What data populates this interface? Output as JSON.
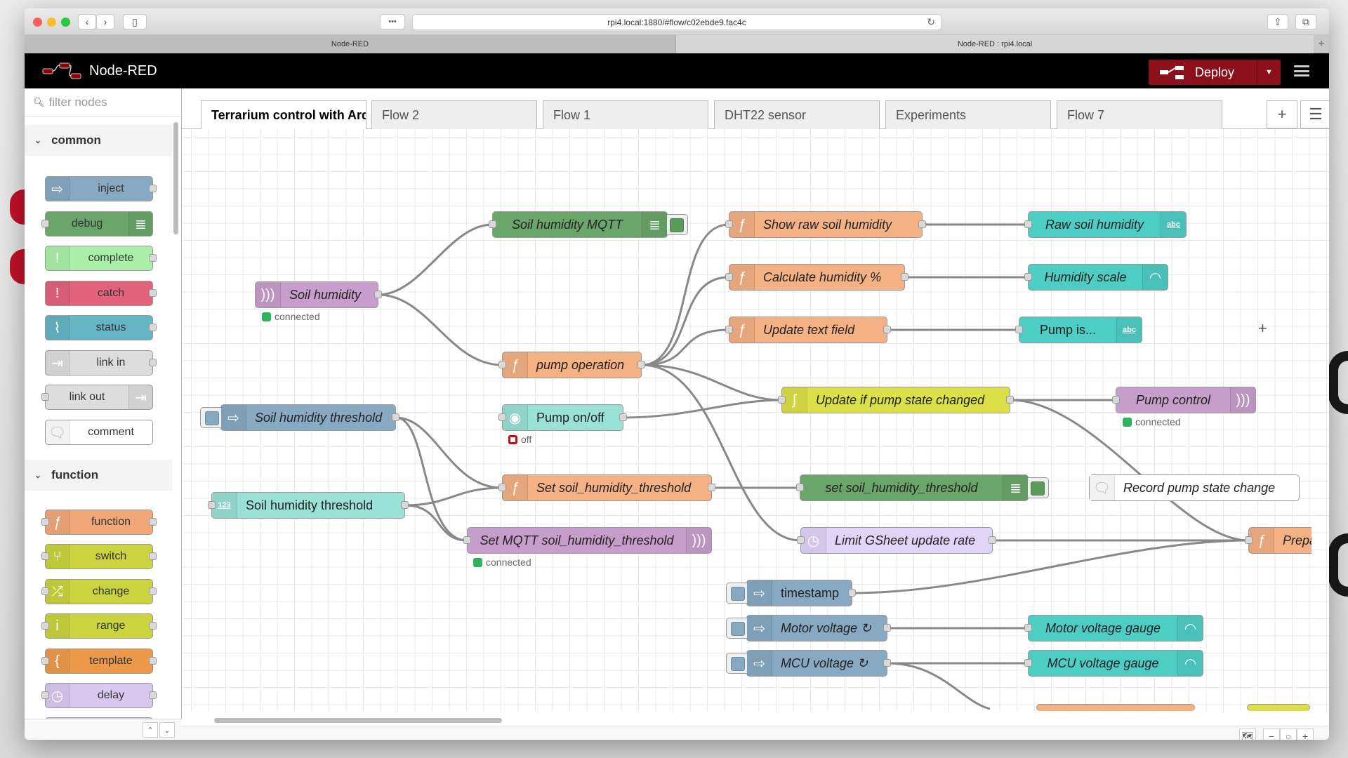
{
  "browser": {
    "url": "rpi4.local:1880/#flow/c02ebde9.fac4c",
    "tabs": [
      {
        "label": "Node-RED",
        "active": false
      },
      {
        "label": "Node-RED : rpi4.local",
        "active": true
      }
    ],
    "reader_icon": "•••",
    "new_tab": "+"
  },
  "header": {
    "app_name": "Node-RED",
    "deploy_label": "Deploy",
    "colors": {
      "deploy_bg": "#8c101c",
      "header_bg": "#000000"
    }
  },
  "palette": {
    "filter_placeholder": "filter nodes",
    "categories": [
      {
        "name": "common",
        "nodes": [
          {
            "label": "inject",
            "icon": "arrow-right-icon",
            "color": "#87a9c2"
          },
          {
            "label": "debug",
            "icon": "list-icon",
            "color": "#87bd87"
          },
          {
            "label": "complete",
            "icon": "exclamation-icon",
            "color": "#c0edc0"
          },
          {
            "label": "catch",
            "icon": "exclamation-icon",
            "color": "#e49191"
          },
          {
            "label": "status",
            "icon": "pulse-icon",
            "color": "#94c1d0"
          },
          {
            "label": "link in",
            "icon": "link-in-icon",
            "color": "#dddddd"
          },
          {
            "label": "link out",
            "icon": "link-out-icon",
            "color": "#dddddd"
          },
          {
            "label": "comment",
            "icon": "comment-icon",
            "color": "#ffffff"
          }
        ]
      },
      {
        "name": "function",
        "nodes": [
          {
            "label": "function",
            "icon": "function-icon",
            "color": "#fdd0a2"
          },
          {
            "label": "switch",
            "icon": "switch-icon",
            "color": "#e2d96e"
          },
          {
            "label": "change",
            "icon": "shuffle-icon",
            "color": "#e2d96e"
          },
          {
            "label": "range",
            "icon": "range-icon",
            "color": "#e2d96e"
          },
          {
            "label": "template",
            "icon": "brace-icon",
            "color": "#f0a15c"
          },
          {
            "label": "delay",
            "icon": "timer-icon",
            "color": "#e6e0f8"
          }
        ]
      }
    ]
  },
  "flow_tabs": [
    {
      "label": "Terrarium control with Arduino",
      "active": true
    },
    {
      "label": "Flow 2",
      "active": false
    },
    {
      "label": "Flow 1",
      "active": false
    },
    {
      "label": "DHT22 sensor",
      "active": false
    },
    {
      "label": "Experiments",
      "active": false
    },
    {
      "label": "Flow 7",
      "active": false
    }
  ],
  "flow": {
    "nodes": [
      {
        "id": "n1",
        "label": "Soil humidity MQTT",
        "type": "debug",
        "italic": true
      },
      {
        "id": "n2",
        "label": "Soil humidity",
        "type": "mqtt in",
        "italic": true,
        "status": "connected",
        "status_color": "#2db35b"
      },
      {
        "id": "n3",
        "label": "Show raw soil humidity",
        "type": "function",
        "italic": true
      },
      {
        "id": "n4",
        "label": "Raw soil humidity",
        "type": "ui_text",
        "italic": true,
        "badge": "abc"
      },
      {
        "id": "n5",
        "label": "Calculate humidity %",
        "type": "function",
        "italic": true
      },
      {
        "id": "n6",
        "label": "Humidity scale",
        "type": "ui_gauge",
        "italic": true
      },
      {
        "id": "n7",
        "label": "Update text field",
        "type": "function",
        "italic": true
      },
      {
        "id": "n8",
        "label": "Pump is...",
        "type": "ui_text",
        "italic": false,
        "badge": "abc"
      },
      {
        "id": "n9",
        "label": "pump operation",
        "type": "function",
        "italic": true
      },
      {
        "id": "n10",
        "label": "Update if pump state changed",
        "type": "rbe",
        "italic": true
      },
      {
        "id": "n11",
        "label": "Pump control",
        "type": "mqtt out",
        "italic": true,
        "status": "connected",
        "status_color": "#2db35b"
      },
      {
        "id": "n12",
        "label": "Soil humidity threshold",
        "type": "inject",
        "italic": true
      },
      {
        "id": "n13",
        "label": "Pump on/off",
        "type": "ui_switch",
        "italic": false,
        "status": "off",
        "status_color": "#b11111"
      },
      {
        "id": "n14",
        "label": "Set soil_humidity_threshold",
        "type": "function",
        "italic": true
      },
      {
        "id": "n15",
        "label": "set soil_humidity_threshold",
        "type": "debug",
        "italic": true
      },
      {
        "id": "n16",
        "label": "Record pump state change",
        "type": "comment",
        "italic": true
      },
      {
        "id": "n17",
        "label": "Soil humidity threshold",
        "type": "ui_numeric",
        "italic": false,
        "badge": "123"
      },
      {
        "id": "n18",
        "label": "Set MQTT soil_humidity_threshold",
        "type": "mqtt out",
        "italic": true,
        "status": "connected",
        "status_color": "#2db35b"
      },
      {
        "id": "n19",
        "label": "Limit GSheet update rate",
        "type": "delay",
        "italic": true
      },
      {
        "id": "n20",
        "label": "Prepa",
        "type": "function",
        "italic": true
      },
      {
        "id": "n21",
        "label": "timestamp",
        "type": "inject",
        "italic": false
      },
      {
        "id": "n22",
        "label": "Motor voltage ↻",
        "type": "inject",
        "italic": true
      },
      {
        "id": "n23",
        "label": "Motor voltage gauge",
        "type": "ui_gauge",
        "italic": true
      },
      {
        "id": "n24",
        "label": "MCU voltage ↻",
        "type": "inject",
        "italic": true
      },
      {
        "id": "n25",
        "label": "MCU voltage gauge",
        "type": "ui_gauge",
        "italic": true
      }
    ]
  },
  "footer": {
    "map_icon": "map-icon",
    "zoom_out": "−",
    "zoom_reset": "○",
    "zoom_in": "+"
  }
}
